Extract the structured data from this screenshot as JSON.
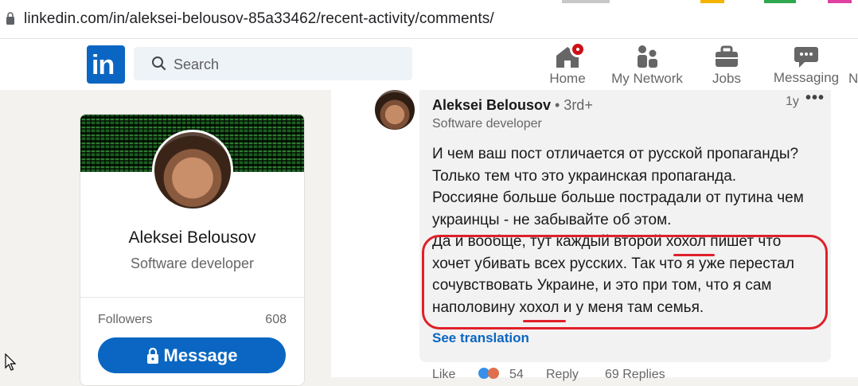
{
  "browser": {
    "url": "linkedin.com/in/aleksei-belousov-85a33462/recent-activity/comments/"
  },
  "nav": {
    "logo": "in",
    "search_placeholder": "Search",
    "items": [
      {
        "label": "Home",
        "icon": "home-icon"
      },
      {
        "label": "My Network",
        "icon": "network-icon"
      },
      {
        "label": "Jobs",
        "icon": "briefcase-icon"
      },
      {
        "label": "Messaging",
        "icon": "messaging-icon"
      },
      {
        "label": "N",
        "icon": "notifications-icon"
      }
    ]
  },
  "profile": {
    "name": "Aleksei Belousov",
    "headline": "Software developer",
    "followers_label": "Followers",
    "followers_count": "608",
    "message_button": "Message"
  },
  "comment": {
    "author": "Aleksei Belousov",
    "degree": "• 3rd+",
    "headline": "Software developer",
    "time": "1y",
    "more": "•••",
    "text": "И чем ваш пост отличается от русской пропаганды?\nТолько тем что это украинская пропаганда.\nРоссияне больше больше пострадали от путина чем\nукраинцы - не забывайте об этом.\nДа и вообще, тут каждый второй хохол пишет что\nхочет убивать всех русских. Так что я уже перестал\nсочувствовать Украине, и это при том, что я сам\nнаполовину хохол и у меня там семья.",
    "see_translation": "See translation",
    "like": "Like",
    "reactions": "54",
    "reply": "Reply",
    "replies": "69 Replies"
  },
  "colors": {
    "accent": "#0a66c2",
    "highlight": "#e0202a"
  }
}
